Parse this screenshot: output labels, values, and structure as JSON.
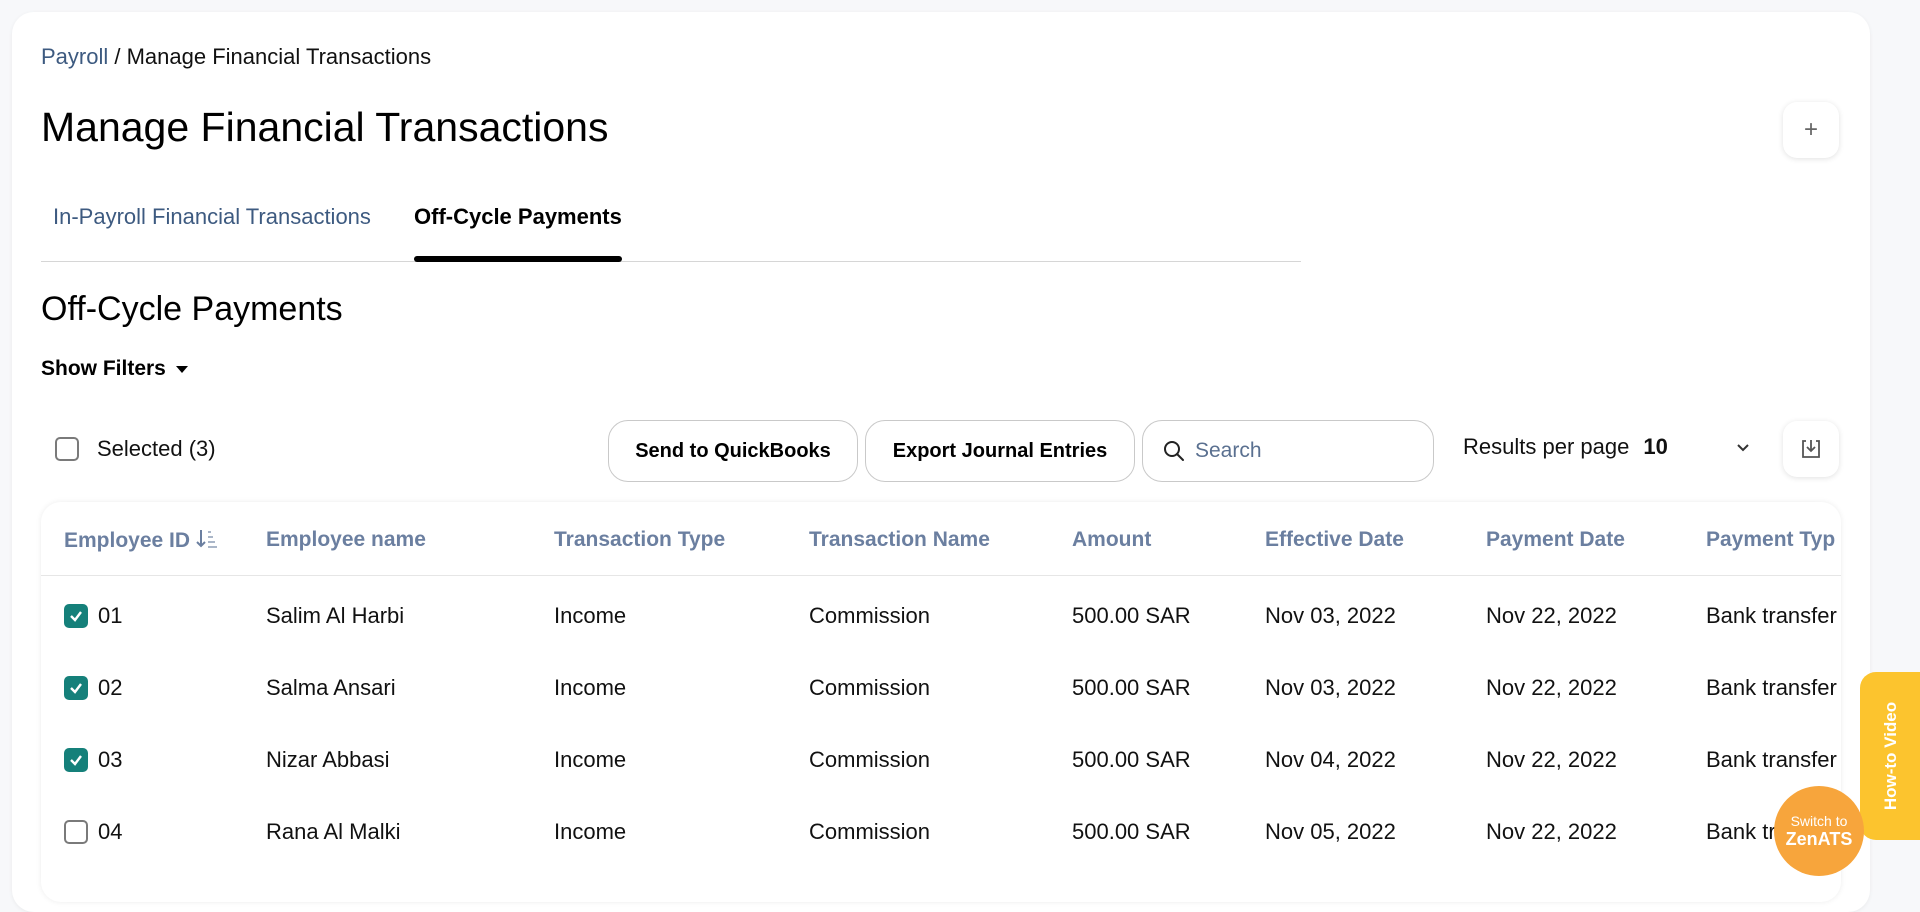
{
  "breadcrumb": {
    "parent": "Payroll",
    "separator": " / ",
    "current": "Manage Financial Transactions"
  },
  "page_title": "Manage Financial Transactions",
  "tabs": [
    {
      "label": "In-Payroll Financial Transactions",
      "active": false
    },
    {
      "label": "Off-Cycle Payments",
      "active": true
    }
  ],
  "section_title": "Off-Cycle Payments",
  "filters_label": "Show Filters",
  "selected_label": "Selected (3)",
  "buttons": {
    "quickbooks": "Send to QuickBooks",
    "journal": "Export Journal Entries"
  },
  "search": {
    "placeholder": "Search",
    "value": ""
  },
  "results_per_page": {
    "label": "Results per page",
    "value": "10"
  },
  "table": {
    "headers": [
      "Employee ID",
      "Employee name",
      "Transaction Type",
      "Transaction Name",
      "Amount",
      "Effective Date",
      "Payment Date",
      "Payment Typ"
    ],
    "rows": [
      {
        "checked": true,
        "id": "01",
        "name": "Salim Al Harbi",
        "type": "Income",
        "tname": "Commission",
        "amount": "500.00 SAR",
        "effective": "Nov 03, 2022",
        "payment": "Nov 22, 2022",
        "ptype": "Bank transfer"
      },
      {
        "checked": true,
        "id": "02",
        "name": "Salma Ansari",
        "type": "Income",
        "tname": "Commission",
        "amount": "500.00 SAR",
        "effective": "Nov 03, 2022",
        "payment": "Nov 22, 2022",
        "ptype": "Bank transfer"
      },
      {
        "checked": true,
        "id": "03",
        "name": "Nizar Abbasi",
        "type": "Income",
        "tname": "Commission",
        "amount": "500.00 SAR",
        "effective": "Nov 04, 2022",
        "payment": "Nov 22, 2022",
        "ptype": "Bank transfer"
      },
      {
        "checked": false,
        "id": "04",
        "name": "Rana Al Malki",
        "type": "Income",
        "tname": "Commission",
        "amount": "500.00 SAR",
        "effective": "Nov 05, 2022",
        "payment": "Nov 22, 2022",
        "ptype": "Bank tr"
      }
    ]
  },
  "howto_label": "How-to Video",
  "switch": {
    "line1": "Switch to",
    "line2": "ZenATS"
  },
  "colors": {
    "accent_teal": "#15807a",
    "link": "#3d5a80",
    "header_text": "#6b7fa0",
    "howto": "#fcc42e",
    "switch": "#f7a53c"
  }
}
